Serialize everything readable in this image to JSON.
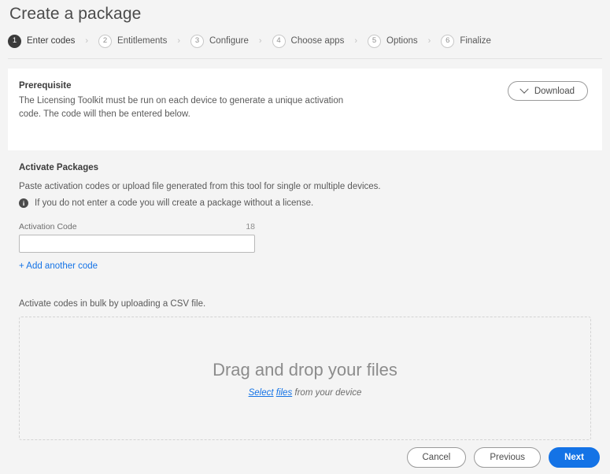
{
  "header": {
    "title": "Create a package"
  },
  "stepper": {
    "separator": "›",
    "steps": [
      {
        "number": "1",
        "label": "Enter codes",
        "active": true
      },
      {
        "number": "2",
        "label": "Entitlements",
        "active": false
      },
      {
        "number": "3",
        "label": "Configure",
        "active": false
      },
      {
        "number": "4",
        "label": "Choose apps",
        "active": false
      },
      {
        "number": "5",
        "label": "Options",
        "active": false
      },
      {
        "number": "6",
        "label": "Finalize",
        "active": false
      }
    ]
  },
  "prerequisite": {
    "title": "Prerequisite",
    "body": "The Licensing Toolkit must be run on each device to generate a unique activation code. The code will then be entered below.",
    "download_label": "Download",
    "download_icon": "chevron-down-icon"
  },
  "activate": {
    "title": "Activate Packages",
    "description": "Paste activation codes or upload file generated from this tool for single or multiple devices.",
    "note_icon": "info-icon",
    "note": "If you do not enter a code you will create a package without a license.",
    "field": {
      "label": "Activation Code",
      "counter": "18",
      "value": "",
      "placeholder": ""
    },
    "add_another_label": "+ Add another code"
  },
  "bulk": {
    "description": "Activate codes in bulk by uploading a CSV file.",
    "dropzone_title": "Drag and drop your files",
    "select_link_1": "Select",
    "select_link_2": "files",
    "select_suffix": " from your device"
  },
  "footer": {
    "cancel_label": "Cancel",
    "previous_label": "Previous",
    "next_label": "Next"
  },
  "colors": {
    "accent": "#1473e6",
    "page_background": "#f4f4f4",
    "card_background": "#ffffff",
    "text": "#4b4b4b"
  }
}
